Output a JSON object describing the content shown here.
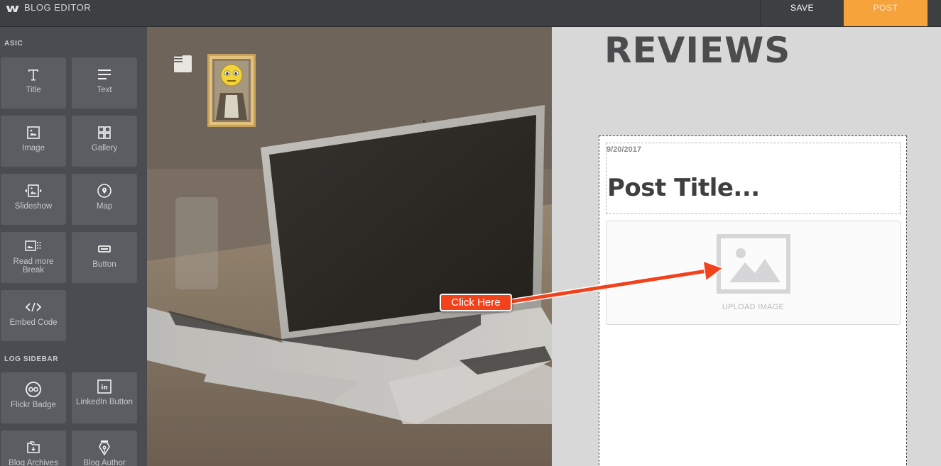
{
  "topbar": {
    "logo_glyph": "w",
    "title": "BLOG EDITOR",
    "save_label": "SAVE",
    "post_label": "POST",
    "accent_color": "#f6a33b"
  },
  "sidebar": {
    "section_basic": "ASIC",
    "section_blog_sidebar": "LOG SIDEBAR",
    "basic_items": [
      {
        "label": "Title",
        "icon": "title-icon"
      },
      {
        "label": "Text",
        "icon": "text-icon"
      },
      {
        "label": "Image",
        "icon": "image-icon"
      },
      {
        "label": "Gallery",
        "icon": "gallery-icon"
      },
      {
        "label": "Slideshow",
        "icon": "slideshow-icon"
      },
      {
        "label": "Map",
        "icon": "map-pin-icon"
      },
      {
        "label": "Read more Break",
        "icon": "read-more-icon"
      },
      {
        "label": "Button",
        "icon": "button-icon"
      },
      {
        "label": "Embed Code",
        "icon": "code-icon"
      }
    ],
    "blog_items": [
      {
        "label": "Flickr Badge",
        "icon": "flickr-icon"
      },
      {
        "label": "LinkedIn Button",
        "icon": "linkedin-icon"
      },
      {
        "label": "Blog Archives",
        "icon": "archive-icon"
      },
      {
        "label": "Blog Author",
        "icon": "pen-nib-icon"
      }
    ]
  },
  "page": {
    "heading": "REVIEWS",
    "post": {
      "date": "9/20/2017",
      "title": "Post Title...",
      "upload_label": "UPLOAD IMAGE"
    }
  },
  "annotation": {
    "callout_text": "Click Here",
    "color": "#f1421c"
  }
}
